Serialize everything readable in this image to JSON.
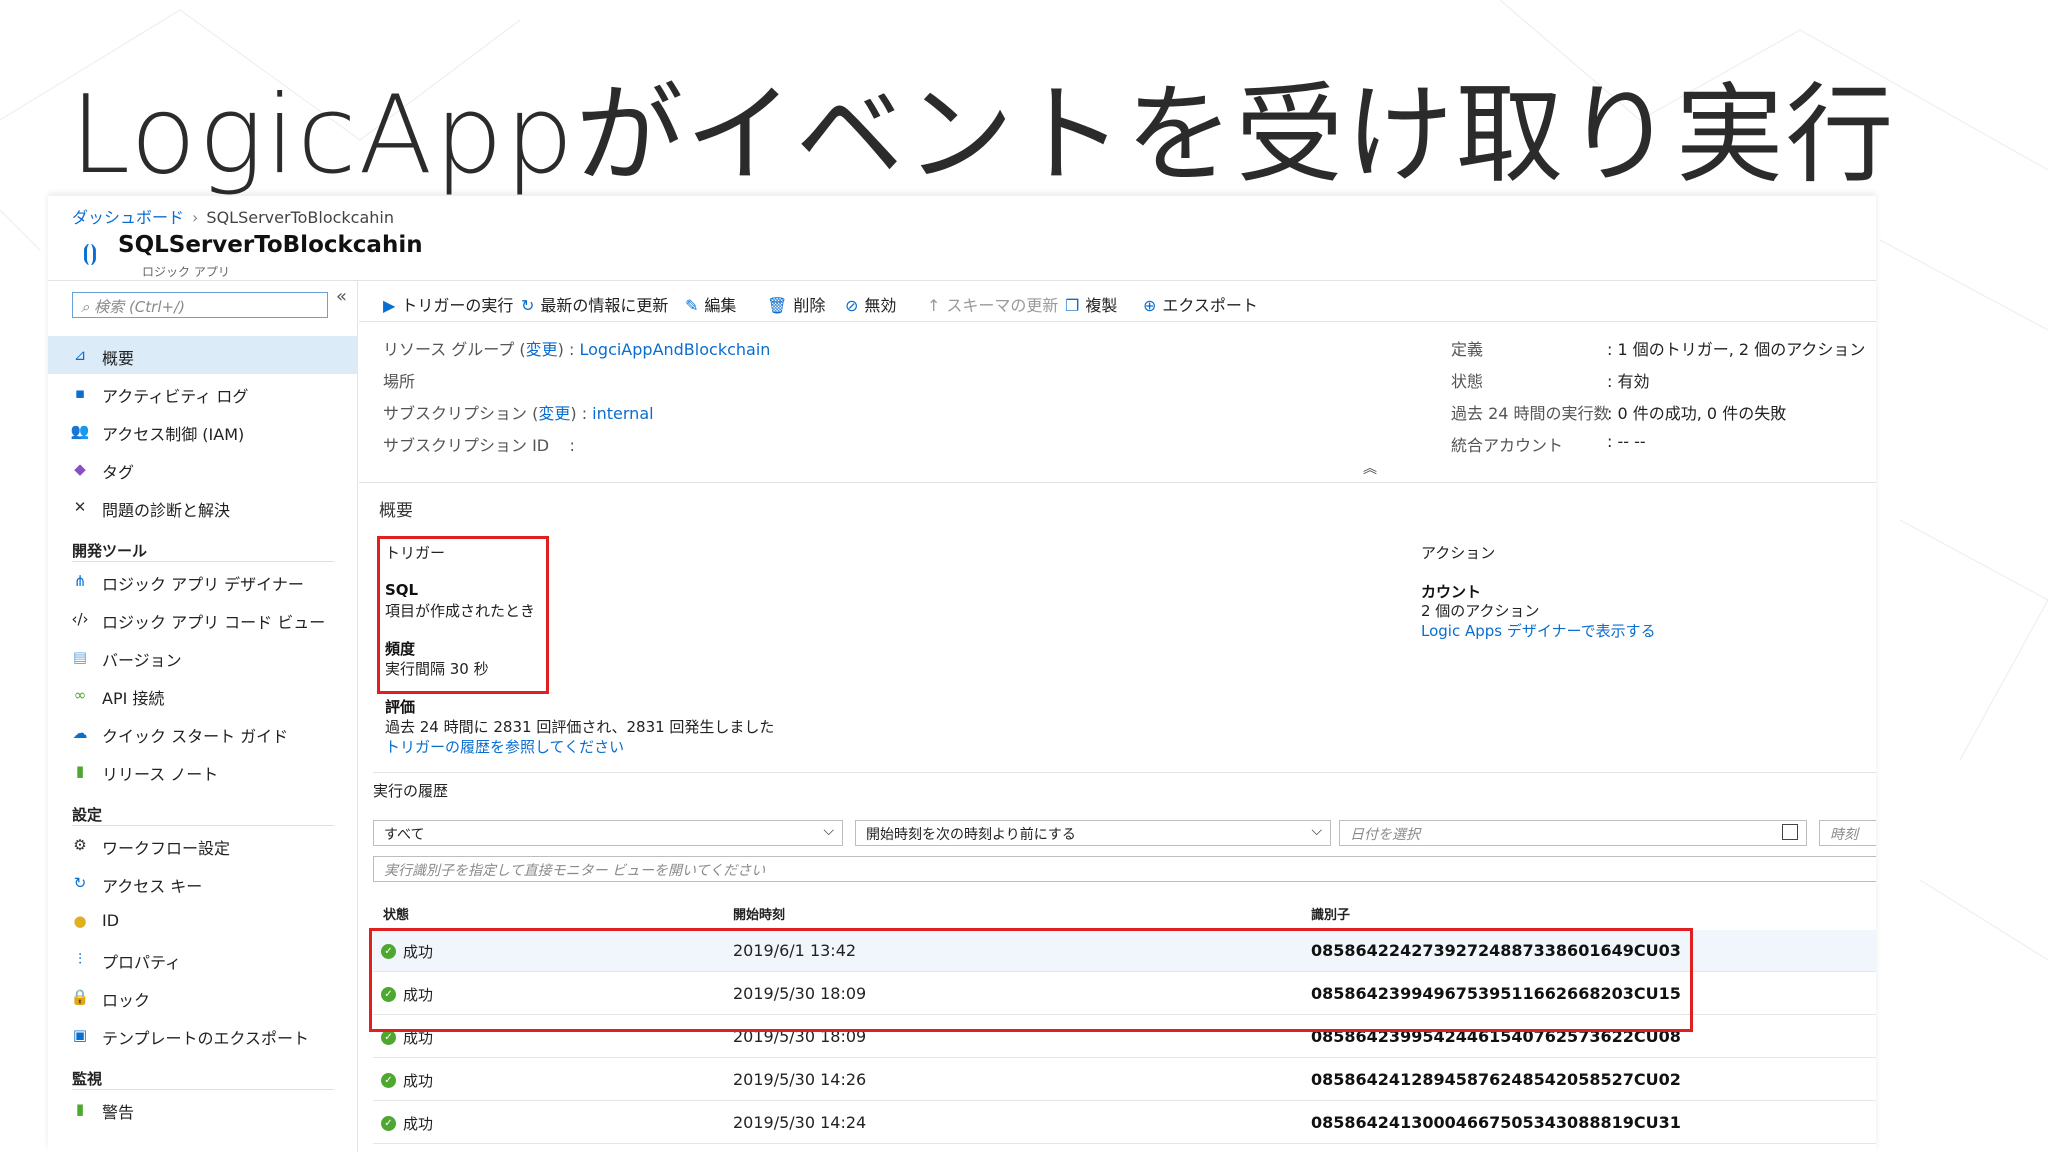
{
  "slide": {
    "title": "LogicAppがイベントを受け取り実行"
  },
  "breadcrumb": {
    "home": "ダッシュボード",
    "current": "SQLServerToBlockcahin"
  },
  "resource": {
    "title": "SQLServerToBlockcahin",
    "subtitle": "ロジック アプリ",
    "icon": "logic-app-icon"
  },
  "sidebar": {
    "search_placeholder": "検索 (Ctrl+/)",
    "collapse": "«",
    "items": [
      {
        "label": "概要",
        "icon": "overview-icon",
        "glyph": "⊿",
        "color": "#0a6ed1"
      },
      {
        "label": "アクティビティ ログ",
        "icon": "activity-log-icon",
        "glyph": "▪",
        "color": "#0a6ed1"
      },
      {
        "label": "アクセス制御 (IAM)",
        "icon": "iam-icon",
        "glyph": "👥",
        "color": "#0a6ed1"
      },
      {
        "label": "タグ",
        "icon": "tag-icon",
        "glyph": "◆",
        "color": "#8a4fc1"
      },
      {
        "label": "問題の診断と解決",
        "icon": "wrench-icon",
        "glyph": "✕",
        "color": "#333333"
      }
    ],
    "section_dev": "開発ツール",
    "dev_items": [
      {
        "label": "ロジック アプリ デザイナー",
        "icon": "designer-icon",
        "glyph": "⋔",
        "color": "#0a6ed1"
      },
      {
        "label": "ロジック アプリ コード ビュー",
        "icon": "code-icon",
        "glyph": "‹/›",
        "color": "#222222"
      },
      {
        "label": "バージョン",
        "icon": "version-icon",
        "glyph": "▤",
        "color": "#6aa0d8"
      },
      {
        "label": "API 接続",
        "icon": "api-connection-icon",
        "glyph": "∞",
        "color": "#4ea72e"
      },
      {
        "label": "クイック スタート ガイド",
        "icon": "quickstart-icon",
        "glyph": "☁",
        "color": "#0a6ed1"
      },
      {
        "label": "リリース ノート",
        "icon": "release-notes-icon",
        "glyph": "▮",
        "color": "#4ea72e"
      }
    ],
    "section_settings": "設定",
    "settings_items": [
      {
        "label": "ワークフロー設定",
        "icon": "gear-icon",
        "glyph": "⚙",
        "color": "#333333"
      },
      {
        "label": "アクセス キー",
        "icon": "access-key-icon",
        "glyph": "↻",
        "color": "#0a6ed1"
      },
      {
        "label": "ID",
        "icon": "identity-icon",
        "glyph": "●",
        "color": "#e0b020"
      },
      {
        "label": "プロパティ",
        "icon": "properties-icon",
        "glyph": "⫶",
        "color": "#0a6ed1"
      },
      {
        "label": "ロック",
        "icon": "lock-icon",
        "glyph": "🔒",
        "color": "#111111"
      },
      {
        "label": "テンプレートのエクスポート",
        "icon": "export-template-icon",
        "glyph": "▣",
        "color": "#0a6ed1"
      }
    ],
    "section_monitor": "監視",
    "monitor_items": [
      {
        "label": "警告",
        "icon": "alert-icon",
        "glyph": "▮",
        "color": "#4ea72e"
      }
    ]
  },
  "toolbar": {
    "run_trigger": "トリガーの実行",
    "refresh": "最新の情報に更新",
    "edit": "編集",
    "delete": "削除",
    "disable": "無効",
    "update_schema": "スキーマの更新",
    "clone": "複製",
    "export": "エクスポート"
  },
  "essentials": {
    "resource_group_label": "リソース グループ",
    "change": "変更",
    "resource_group_value": "LogciAppAndBlockchain",
    "location_label": "場所",
    "subscription_label": "サブスクリプション",
    "subscription_value": "internal",
    "subscription_id_label": "サブスクリプション ID",
    "definition_label": "定義",
    "definition_value": "1 個のトリガー, 2 個のアクション",
    "state_label": "状態",
    "state_value": "有効",
    "runs_label": "過去 24 時間の実行数",
    "runs_value": "0 件の成功, 0 件の失敗",
    "integration_label": "統合アカウント",
    "integration_value": "-- --"
  },
  "summary": {
    "title": "概要",
    "trigger_heading": "トリガー",
    "trigger_name": "SQL",
    "trigger_desc": "項目が作成されたとき",
    "frequency_heading": "頻度",
    "frequency_value": "実行間隔 30 秒",
    "eval_heading": "評価",
    "eval_value": "過去 24 時間に 2831 回評価され、2831 回発生しました",
    "eval_link": "トリガーの履歴を参照してください",
    "actions_heading": "アクション",
    "action_name": "カウント",
    "action_count": "2 個のアクション",
    "action_link": "Logic Apps デザイナーで表示する"
  },
  "history": {
    "title": "実行の履歴",
    "filter_status": "すべて",
    "filter_time": "開始時刻を次の時刻より前にする",
    "date_placeholder": "日付を選択",
    "time_placeholder": "時刻",
    "run_id_placeholder": "実行識別子を指定して直接モニター ビューを開いてください",
    "columns": [
      "状態",
      "開始時刻",
      "識別子"
    ],
    "rows": [
      {
        "status": "成功",
        "time": "2019/6/1 13:42",
        "id": "08586422427392724887338601649CU03"
      },
      {
        "status": "成功",
        "time": "2019/5/30 18:09",
        "id": "08586423994967539511662668203CU15"
      },
      {
        "status": "成功",
        "time": "2019/5/30 18:09",
        "id": "08586423995424461540762573622CU08"
      },
      {
        "status": "成功",
        "time": "2019/5/30 14:26",
        "id": "08586424128945876248542058527CU02"
      },
      {
        "status": "成功",
        "time": "2019/5/30 14:24",
        "id": "08586424130004667505343088819CU31"
      }
    ]
  },
  "colors": {
    "accent": "#0a6ed1",
    "highlight_box": "#e02020",
    "success": "#4ea72e"
  }
}
